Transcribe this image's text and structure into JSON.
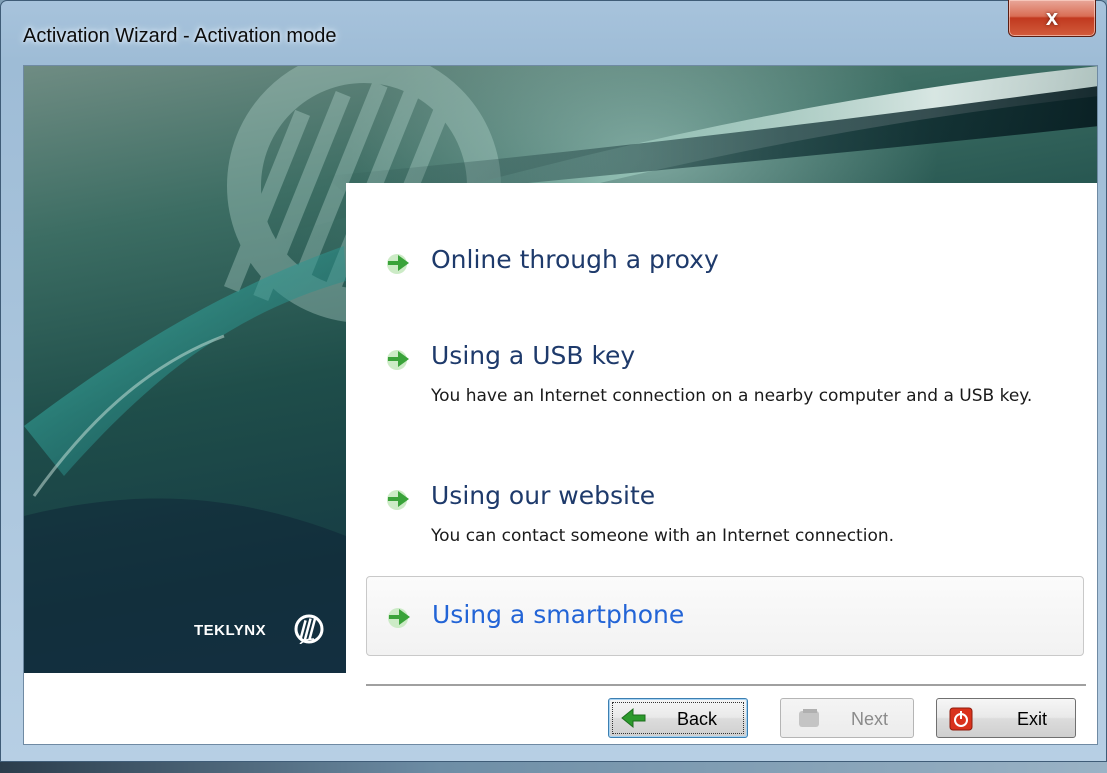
{
  "window": {
    "title": "Activation Wizard - Activation mode",
    "close_label": "x"
  },
  "banner": {
    "logo_text": "TEKLYNX"
  },
  "options": [
    {
      "title": "Online through a proxy",
      "description": ""
    },
    {
      "title": "Using a USB key",
      "description": "You have an Internet connection on a nearby computer and a USB key."
    },
    {
      "title": "Using our website",
      "description": "You can contact someone with an Internet connection."
    },
    {
      "title": "Using a smartphone",
      "description": ""
    }
  ],
  "buttons": {
    "back": "Back",
    "next": "Next",
    "exit": "Exit"
  },
  "colors": {
    "arrow_green": "#3aa33a",
    "option_title": "#1e3a6b",
    "hover_title": "#2264d6",
    "exit_red": "#d9321c"
  }
}
